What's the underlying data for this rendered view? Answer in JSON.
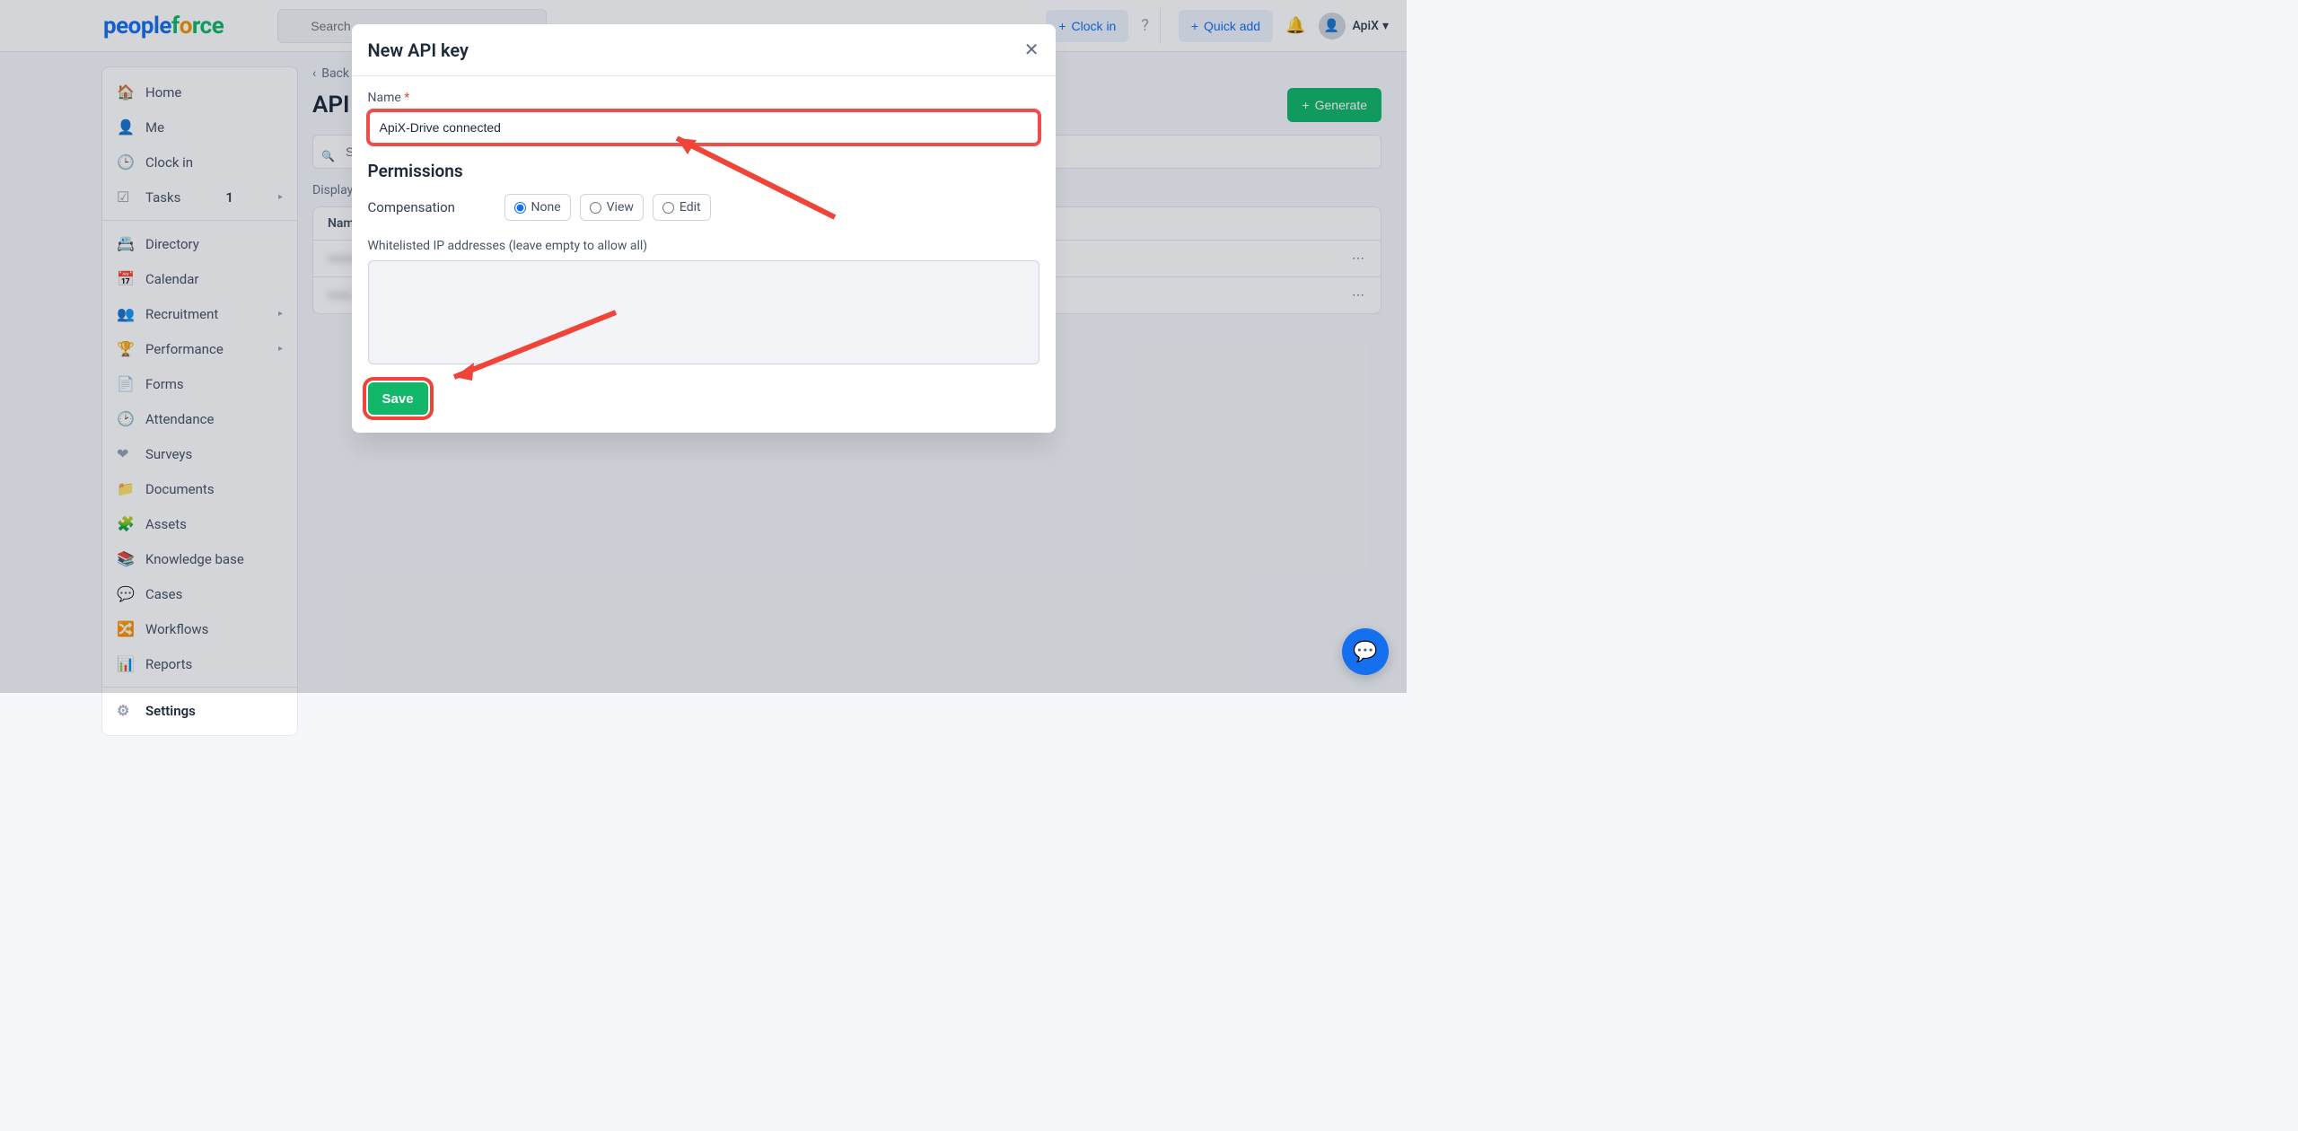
{
  "brand": {
    "a": "people",
    "b": "f",
    "c": "o",
    "d": "rce"
  },
  "topbar": {
    "search_placeholder": "Search",
    "clock_in": "Clock in",
    "quick_add": "Quick add",
    "user_name": "ApiX"
  },
  "sidebar": {
    "items": [
      {
        "icon": "🏠",
        "label": "Home"
      },
      {
        "icon": "👤",
        "label": "Me"
      },
      {
        "icon": "🕒",
        "label": "Clock in"
      },
      {
        "icon": "☑",
        "label": "Tasks",
        "badge": "1",
        "expand": true
      },
      {
        "sep": true
      },
      {
        "icon": "📇",
        "label": "Directory"
      },
      {
        "icon": "📅",
        "label": "Calendar"
      },
      {
        "icon": "👥",
        "label": "Recruitment",
        "expand": true
      },
      {
        "icon": "🏆",
        "label": "Performance",
        "expand": true
      },
      {
        "icon": "📄",
        "label": "Forms"
      },
      {
        "icon": "🕑",
        "label": "Attendance"
      },
      {
        "icon": "❤",
        "label": "Surveys"
      },
      {
        "icon": "📁",
        "label": "Documents"
      },
      {
        "icon": "🧩",
        "label": "Assets"
      },
      {
        "icon": "📚",
        "label": "Knowledge base"
      },
      {
        "icon": "💬",
        "label": "Cases"
      },
      {
        "icon": "🔀",
        "label": "Workflows"
      },
      {
        "icon": "📊",
        "label": "Reports"
      },
      {
        "sep": true
      },
      {
        "icon": "⚙",
        "label": "Settings",
        "active": true
      }
    ]
  },
  "main": {
    "back": "Back",
    "title": "API keys",
    "generate": "Generate",
    "search_placeholder": "Search",
    "displaying": "Displaying",
    "col_name": "Name"
  },
  "modal": {
    "title": "New API key",
    "name_label": "Name",
    "name_value": "ApiX-Drive connected",
    "permissions_title": "Permissions",
    "comp_label": "Compensation",
    "radio_none": "None",
    "radio_view": "View",
    "radio_edit": "Edit",
    "ip_label": "Whitelisted IP addresses (leave empty to allow all)",
    "save": "Save"
  }
}
